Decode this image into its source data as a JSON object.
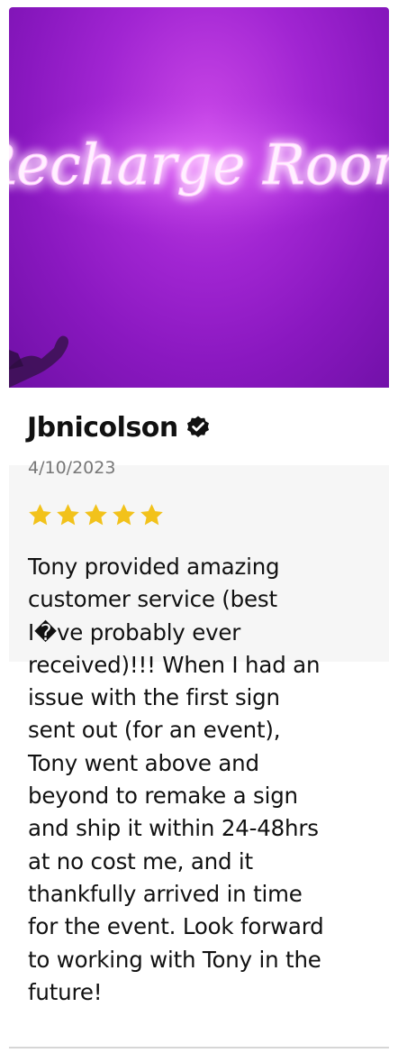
{
  "photo": {
    "sign_text": "Recharge Room"
  },
  "review": {
    "author": "Jbnicolson",
    "date": "4/10/2023",
    "rating": 5,
    "rating_max": 5,
    "body": "Tony provided amazing\ncustomer service (best\nI�ve probably ever\nreceived)!!! When I had an\nissue with the first sign\nsent out (for an event),\nTony went above and\nbeyond to remake a sign\nand ship it within 24-48hrs\nat no cost me, and it\nthankfully arrived in time\nfor the event. Look forward\nto working with Tony in the\nfuture!"
  },
  "colors": {
    "star": "#f2c21b",
    "background_band": "#f6f6f6",
    "photo_purple": "#a125d2",
    "neon_pink": "#ffd8ff"
  },
  "icons": {
    "verified": "verified-check-icon",
    "star": "star-icon"
  }
}
